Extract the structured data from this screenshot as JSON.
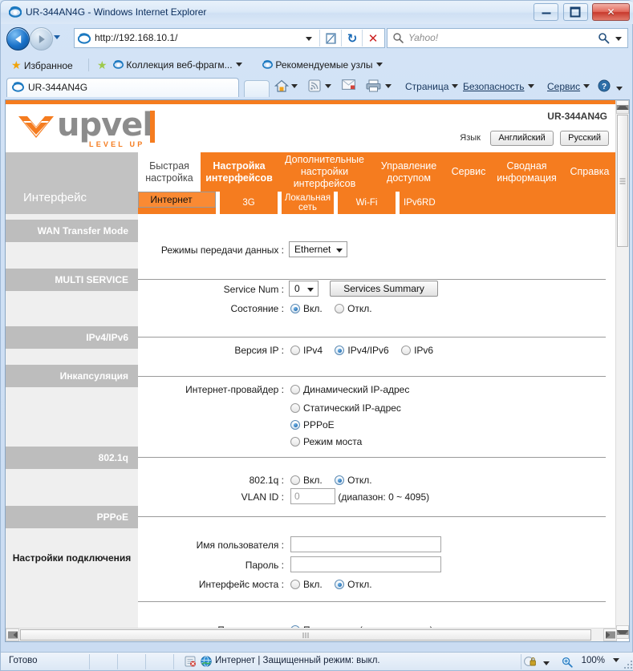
{
  "browser": {
    "title": "UR-344AN4G - Windows Internet Explorer",
    "window_controls": {
      "minimize": "minimize-button",
      "maximize": "maximize-button",
      "close": "✕"
    },
    "address": {
      "value": "http://192.168.10.1/",
      "icon": "ie-icon"
    },
    "search": {
      "placeholder": "Yahoo!",
      "icon": "search-icon"
    },
    "favorites_bar": {
      "favorites_label": "Избранное",
      "items": [
        {
          "label": "Коллекция веб-фрагм...",
          "has_caret": true
        },
        {
          "label": "Рекомендуемые узлы",
          "has_caret": true
        }
      ]
    },
    "tab": {
      "label": "UR-344AN4G"
    },
    "command_bar": {
      "items": [
        {
          "label": "Страница",
          "type": "menu"
        },
        {
          "label": "Безопасность",
          "type": "menu"
        },
        {
          "label": "Сервис",
          "type": "menu"
        }
      ],
      "icons": [
        "home-icon",
        "feeds-icon",
        "mail-icon",
        "print-icon",
        "help-icon"
      ]
    },
    "status": {
      "ready": "Готово",
      "zone": "Интернет | Защищенный режим: выкл.",
      "zoom": "100%"
    }
  },
  "router": {
    "brand": {
      "name": "upvel",
      "tagline": "LEVEL UP"
    },
    "model": "UR-344AN4G",
    "language": {
      "label": "Язык",
      "buttons": [
        {
          "label": "Английский"
        },
        {
          "label": "Русский"
        }
      ]
    },
    "interface_panel_label": "Интерфейс",
    "main_tabs": [
      {
        "label": "Быстрая настройка",
        "state": "white"
      },
      {
        "label": "Настройка интерфейсов",
        "state": "active"
      },
      {
        "label": "Дополнительные настройки интерфейсов",
        "state": "normal"
      },
      {
        "label": "Управление доступом",
        "state": "normal"
      },
      {
        "label": "Сервис",
        "state": "normal"
      },
      {
        "label": "Сводная информация",
        "state": "normal"
      },
      {
        "label": "Справка",
        "state": "normal"
      }
    ],
    "sub_tabs": [
      {
        "label": "Интернет",
        "selected": true
      },
      {
        "label": "3G",
        "selected": false
      },
      {
        "label": "Локальная сеть",
        "selected": false
      },
      {
        "label": "Wi-Fi",
        "selected": false
      },
      {
        "label": "IPv6RD",
        "selected": false
      }
    ],
    "sections": [
      {
        "id": "wan",
        "title": "WAN Transfer Mode",
        "style": "grey"
      },
      {
        "id": "multi",
        "title": "MULTI SERVICE",
        "style": "grey"
      },
      {
        "id": "ipv",
        "title": "IPv4/IPv6",
        "style": "grey"
      },
      {
        "id": "encap",
        "title": "Инкапсуляция",
        "style": "grey"
      },
      {
        "id": "vlan",
        "title": "802.1q",
        "style": "grey"
      },
      {
        "id": "pppoe",
        "title": "PPPoE",
        "style": "grey"
      },
      {
        "id": "conn",
        "title": "Настройки подключения",
        "style": "plain"
      }
    ],
    "form": {
      "transfer_mode": {
        "label": "Режимы передачи данных :",
        "value": "Ethernet"
      },
      "service_num": {
        "label": "Service Num :",
        "value": "0",
        "button": "Services Summary"
      },
      "state": {
        "label": "Состояние :",
        "options": [
          {
            "label": "Вкл.",
            "checked": true
          },
          {
            "label": "Откл.",
            "checked": false
          }
        ]
      },
      "ip_version": {
        "label": "Версия IP :",
        "options": [
          {
            "label": "IPv4",
            "checked": false
          },
          {
            "label": "IPv4/IPv6",
            "checked": true
          },
          {
            "label": "IPv6",
            "checked": false
          }
        ]
      },
      "isp": {
        "label": "Интернет-провайдер :",
        "options": [
          {
            "label": "Динамический IP-адрес",
            "checked": false
          },
          {
            "label": "Статический IP-адрес",
            "checked": false
          },
          {
            "label": "PPPoE",
            "checked": true
          },
          {
            "label": "Режим моста",
            "checked": false
          }
        ]
      },
      "dot1q": {
        "label": "802.1q :",
        "options": [
          {
            "label": "Вкл.",
            "checked": false
          },
          {
            "label": "Откл.",
            "checked": true
          }
        ]
      },
      "vlan_id": {
        "label": "VLAN ID :",
        "value": "0",
        "hint": "(диапазон: 0 ~ 4095)"
      },
      "username": {
        "label": "Имя пользователя :",
        "value": ""
      },
      "password": {
        "label": "Пароль :",
        "value": ""
      },
      "bridge_interface": {
        "label": "Интерфейс моста :",
        "options": [
          {
            "label": "Вкл.",
            "checked": false
          },
          {
            "label": "Откл.",
            "checked": true
          }
        ]
      },
      "connection": {
        "label": "Подключение :",
        "options": [
          {
            "label": "Постоянное (рекомендуется)",
            "checked": true
          }
        ]
      }
    }
  }
}
